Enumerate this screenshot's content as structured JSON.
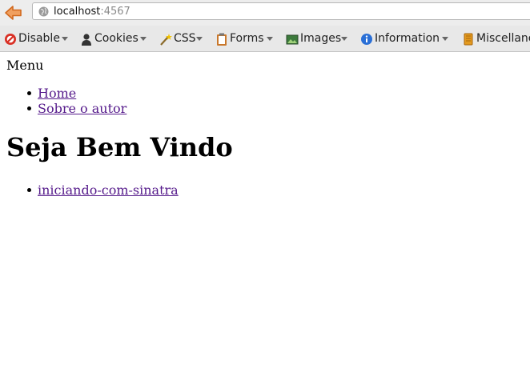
{
  "browser": {
    "url_host": "localhost",
    "url_port": ":4567"
  },
  "toolbar": {
    "items": [
      {
        "label": "Disable",
        "icon": "disable-icon"
      },
      {
        "label": "Cookies",
        "icon": "cookies-icon"
      },
      {
        "label": "CSS",
        "icon": "css-wand-icon"
      },
      {
        "label": "Forms",
        "icon": "forms-clipboard-icon"
      },
      {
        "label": "Images",
        "icon": "images-icon"
      },
      {
        "label": "Information",
        "icon": "information-icon"
      },
      {
        "label": "Miscellane",
        "icon": "miscellaneous-icon"
      }
    ]
  },
  "page": {
    "menu_label": "Menu",
    "menu_links": [
      "Home",
      "Sobre o autor"
    ],
    "heading": "Seja Bem Vindo",
    "posts": [
      "iniciando-com-sinatra"
    ]
  },
  "colors": {
    "link": "#551a8b",
    "back_arrow": "#e8772e",
    "disable_icon": "#d93025",
    "information_icon": "#2a6fd6"
  }
}
